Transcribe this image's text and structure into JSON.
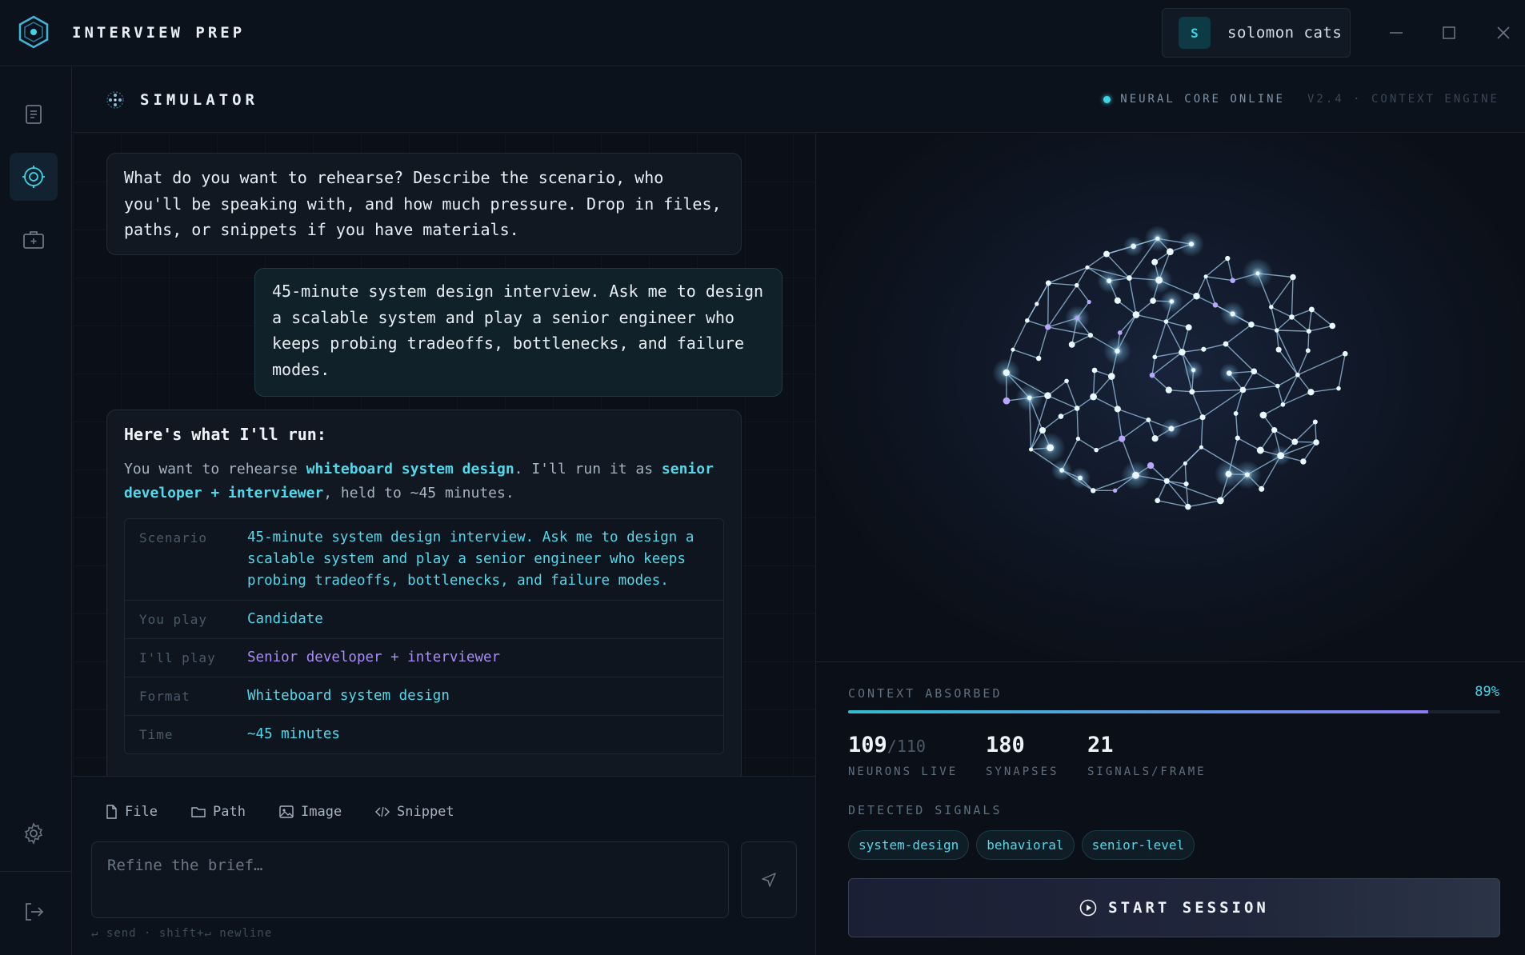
{
  "app": {
    "title": "INTERVIEW PREP"
  },
  "user": {
    "initial": "S",
    "name": "solomon cats"
  },
  "header": {
    "title": "SIMULATOR",
    "status_online": "NEURAL CORE ONLINE",
    "status_version": "V2.4 · CONTEXT ENGINE"
  },
  "chat": {
    "assistant_prompt": "What do you want to rehearse? Describe the scenario, who you'll be speaking with, and how much pressure. Drop in files, paths, or snippets if you have materials.",
    "user_message": "45-minute system design interview. Ask me to design a scalable system and play a senior engineer who keeps probing tradeoffs, bottlenecks, and failure modes.",
    "plan_heading": "Here's what I'll run:",
    "plan_intro_1": "You want to rehearse ",
    "plan_topic": "whiteboard system design",
    "plan_intro_2": ". I'll run it as ",
    "plan_role": "senior developer + interviewer",
    "plan_intro_3": ", held to ~45 minutes.",
    "brief": [
      {
        "key": "Scenario",
        "value": "45-minute system design interview. Ask me to design a scalable system and play a senior engineer who keeps probing tradeoffs, bottlenecks, and failure modes."
      },
      {
        "key": "You play",
        "value": "Candidate"
      },
      {
        "key": "I'll play",
        "value": "Senior developer + interviewer"
      },
      {
        "key": "Format",
        "value": "Whiteboard system design"
      },
      {
        "key": "Time",
        "value": "~45 minutes"
      }
    ]
  },
  "composer": {
    "attach_file": "File",
    "attach_path": "Path",
    "attach_image": "Image",
    "attach_snippet": "Snippet",
    "placeholder": "Refine the brief…",
    "hint": "↵ send · shift+↵ newline"
  },
  "context": {
    "label": "CONTEXT ABSORBED",
    "percent_text": "89%",
    "percent": 0.89,
    "neurons": "109",
    "neurons_total": "/110",
    "neurons_label": "NEURONS LIVE",
    "synapses": "180",
    "synapses_label": "SYNAPSES",
    "signals": "21",
    "signals_label": "SIGNALS/FRAME",
    "detected_label": "DETECTED SIGNALS",
    "tags": [
      "system-design",
      "behavioral",
      "senior-level"
    ],
    "start_label": "START SESSION"
  },
  "colors": {
    "accent": "#3fd4e6",
    "purple": "#a98cf5",
    "background": "#0b1018"
  }
}
